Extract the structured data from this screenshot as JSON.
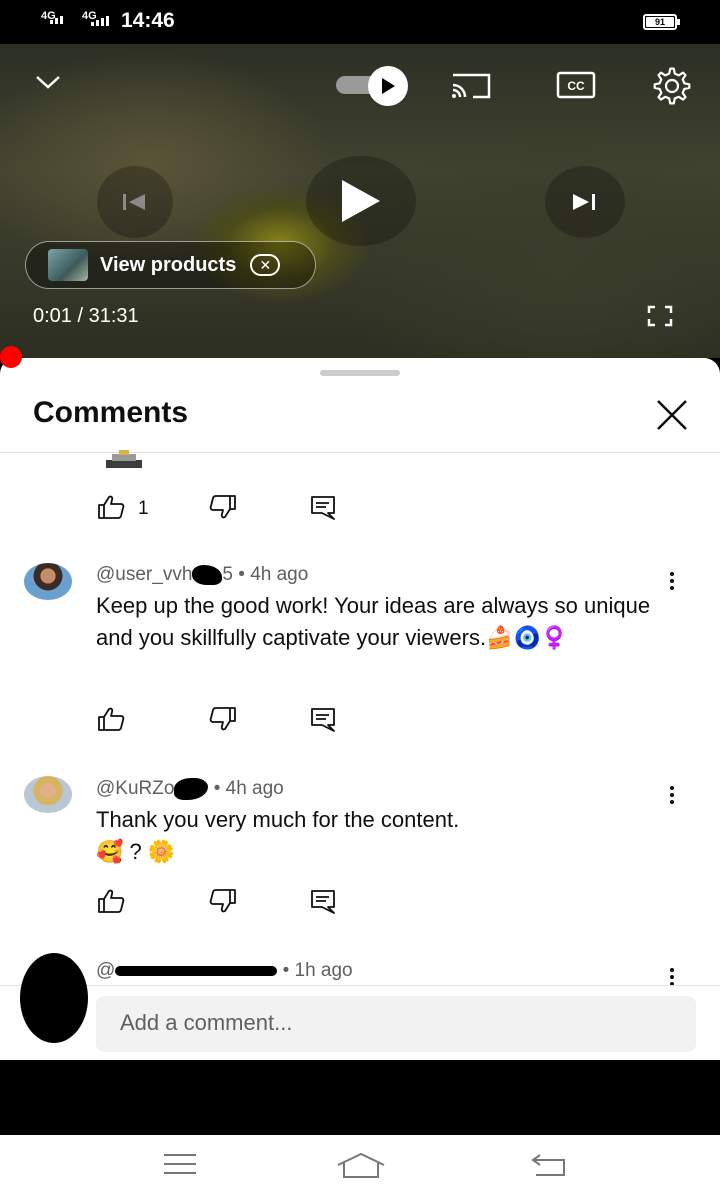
{
  "status_bar": {
    "network_1": "4G",
    "network_2": "4G",
    "time": "14:46",
    "battery": "91"
  },
  "player": {
    "view_products_label": "View products",
    "current_time": "0:01",
    "separator": "/",
    "duration": "31:31",
    "icons": [
      "chevron-down-icon",
      "autoplay-toggle",
      "cast-icon",
      "captions-icon",
      "settings-gear-icon",
      "previous-icon",
      "play-icon",
      "next-icon",
      "fullscreen-icon"
    ]
  },
  "comments_panel": {
    "title": "Comments",
    "top_comment_tail": {
      "like_count": "1"
    },
    "comments": [
      {
        "author_visible": "@user_vvh",
        "author_tail": "5",
        "separator": "•",
        "time": "4h ago",
        "text": "Keep up the good work! Your ideas are always so unique and you skillfully captivate your viewers.🍰🧿♀️"
      },
      {
        "author_visible": "@KuRZo",
        "separator": "•",
        "time": "4h ago",
        "text": "Thank you very much for the content.",
        "text_line2": "🥰 ? 🌼"
      },
      {
        "author_visible": "@",
        "separator": "•",
        "time": "1h ago"
      }
    ],
    "composer_placeholder": "Add a comment..."
  },
  "colors": {
    "progress_accent": "#ff0000",
    "sheet_background": "#ffffff",
    "secondary_text": "#606060"
  }
}
